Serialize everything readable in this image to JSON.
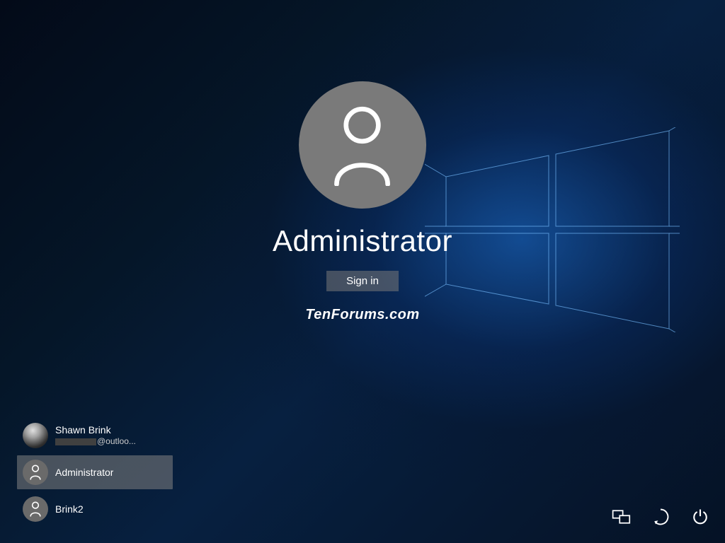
{
  "main": {
    "username": "Administrator",
    "sign_in_label": "Sign in"
  },
  "watermark": "TenForums.com",
  "users": [
    {
      "name": "Shawn Brink",
      "email_suffix": "@outloo...",
      "has_photo": true
    },
    {
      "name": "Administrator",
      "email_suffix": "",
      "has_photo": false
    },
    {
      "name": "Brink2",
      "email_suffix": "",
      "has_photo": false
    }
  ],
  "icons": {
    "network": "network-icon",
    "ease_of_access": "ease-of-access-icon",
    "power": "power-icon"
  }
}
